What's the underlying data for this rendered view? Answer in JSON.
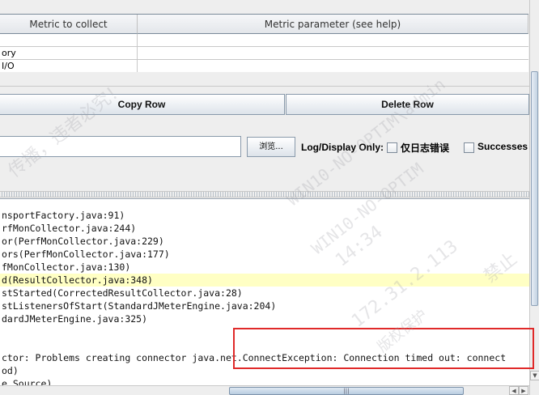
{
  "metrics_table": {
    "col_metric": "Metric to collect",
    "col_param": "Metric parameter (see help)",
    "rows": [
      {
        "metric": "",
        "param": ""
      },
      {
        "metric": "ory",
        "param": ""
      },
      {
        "metric": " I/O",
        "param": ""
      }
    ]
  },
  "buttons": {
    "copy_row": "Copy Row",
    "delete_row": "Delete Row"
  },
  "file_panel": {
    "filename_value": "",
    "browse_label": "浏览...",
    "log_display_label": "Log/Display Only:",
    "errors_only_label": "仅日志错误",
    "successes_label": "Successes"
  },
  "log": {
    "lines": [
      "nsportFactory.java:91)",
      "rfMonCollector.java:244)",
      "or(PerfMonCollector.java:229)",
      "ors(PerfMonCollector.java:177)",
      "fMonCollector.java:130)",
      "d(ResultCollector.java:348)",
      "stStarted(CorrectedResultCollector.java:28)",
      "stListenersOfStart(StandardJMeterEngine.java:204)",
      "dardJMeterEngine.java:325)",
      "",
      "",
      "ctor: Problems creating connector java.net.ConnectException: Connection timed out: connect",
      "od)",
      "e Source)"
    ],
    "highlight_color": "#ffffc4"
  },
  "annotation": {
    "color": "#e02a2a"
  },
  "watermark": {
    "lines": [
      "传播，违者必究！",
      "WIN10-NO-OPTIM\\admin",
      "WIN10-NO-OPTIM",
      "14:34",
      "172.31.2.113",
      "禁止",
      "版权保护"
    ]
  }
}
